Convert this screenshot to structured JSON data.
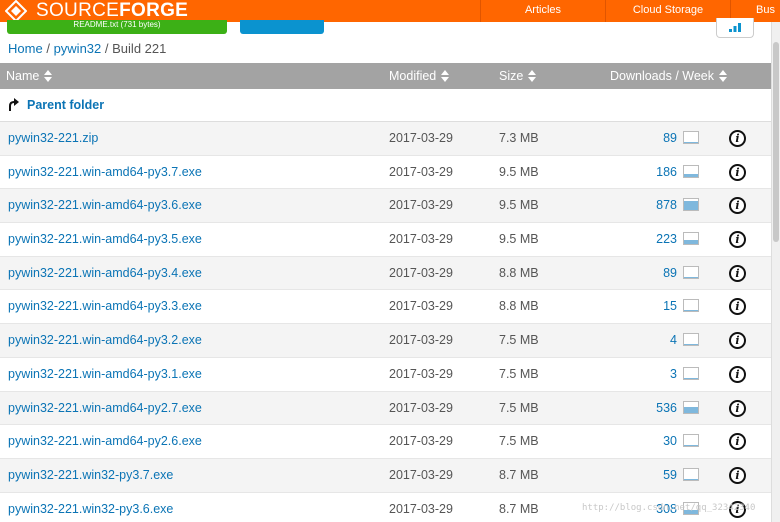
{
  "header": {
    "brand_light": "SOURCE",
    "brand_bold": "FORGE",
    "nav": [
      "Articles",
      "Cloud Storage",
      "Bus"
    ],
    "download_button_label": "README.txt (731 bytes)",
    "colors": {
      "topbar": "#ff6600",
      "green_button": "#3cb016",
      "blue_button": "#0b93cf",
      "link": "#0b74b5",
      "table_header": "#a3a3a3"
    }
  },
  "breadcrumb": {
    "home": "Home",
    "project": "pywin32",
    "current": "Build 221",
    "separator": "/"
  },
  "table": {
    "columns": {
      "name": "Name",
      "modified": "Modified",
      "size": "Size",
      "downloads": "Downloads / Week"
    },
    "parent_folder": "Parent folder",
    "rows": [
      {
        "name": "pywin32-221.zip",
        "modified": "2017-03-29",
        "size": "7.3 MB",
        "downloads": "89",
        "trend": 0.1
      },
      {
        "name": "pywin32-221.win-amd64-py3.7.exe",
        "modified": "2017-03-29",
        "size": "9.5 MB",
        "downloads": "186",
        "trend": 0.3
      },
      {
        "name": "pywin32-221.win-amd64-py3.6.exe",
        "modified": "2017-03-29",
        "size": "9.5 MB",
        "downloads": "878",
        "trend": 0.8
      },
      {
        "name": "pywin32-221.win-amd64-py3.5.exe",
        "modified": "2017-03-29",
        "size": "9.5 MB",
        "downloads": "223",
        "trend": 0.35
      },
      {
        "name": "pywin32-221.win-amd64-py3.4.exe",
        "modified": "2017-03-29",
        "size": "8.8 MB",
        "downloads": "89",
        "trend": 0.1
      },
      {
        "name": "pywin32-221.win-amd64-py3.3.exe",
        "modified": "2017-03-29",
        "size": "8.8 MB",
        "downloads": "15",
        "trend": 0.0
      },
      {
        "name": "pywin32-221.win-amd64-py3.2.exe",
        "modified": "2017-03-29",
        "size": "7.5 MB",
        "downloads": "4",
        "trend": 0.0
      },
      {
        "name": "pywin32-221.win-amd64-py3.1.exe",
        "modified": "2017-03-29",
        "size": "7.5 MB",
        "downloads": "3",
        "trend": 0.0
      },
      {
        "name": "pywin32-221.win-amd64-py2.7.exe",
        "modified": "2017-03-29",
        "size": "7.5 MB",
        "downloads": "536",
        "trend": 0.55
      },
      {
        "name": "pywin32-221.win-amd64-py2.6.exe",
        "modified": "2017-03-29",
        "size": "7.5 MB",
        "downloads": "30",
        "trend": 0.05
      },
      {
        "name": "pywin32-221.win32-py3.7.exe",
        "modified": "2017-03-29",
        "size": "8.7 MB",
        "downloads": "59",
        "trend": 0.08
      },
      {
        "name": "pywin32-221.win32-py3.6.exe",
        "modified": "2017-03-29",
        "size": "8.7 MB",
        "downloads": "308",
        "trend": 0.4
      }
    ]
  },
  "watermark": "http://blog.csdn.net/qq_32342340"
}
